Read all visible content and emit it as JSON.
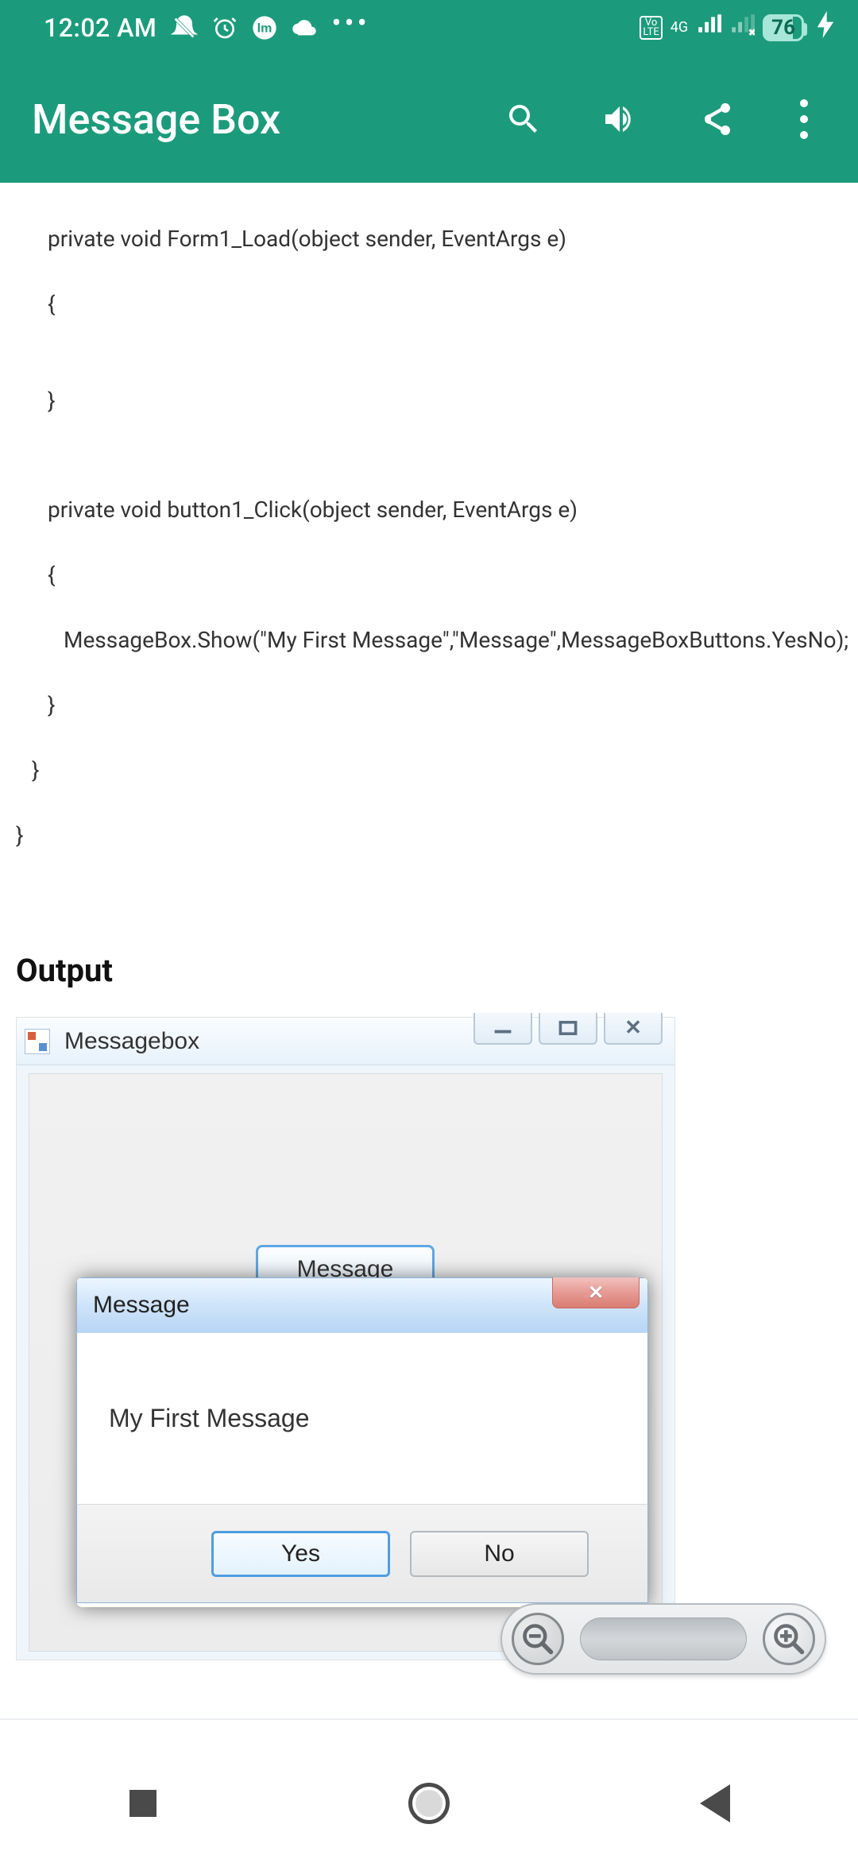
{
  "status": {
    "time": "12:02 AM",
    "network": "4G",
    "volte": "Vo LTE",
    "battery_pct": "76"
  },
  "appbar": {
    "title": "Message Box"
  },
  "code": {
    "l1": "private void Form1_Load(object sender, EventArgs e)",
    "l2": "{",
    "l3": "}",
    "l4": "private void button1_Click(object sender, EventArgs e)",
    "l5": "{",
    "l6": "MessageBox.Show(\"My First Message\",\"Message\",MessageBoxButtons.YesNo);",
    "l7": "}",
    "l8": "}",
    "l9": "}"
  },
  "output": {
    "heading": "Output",
    "window_title": "Messagebox",
    "button_label": "Message",
    "dialog_title": "Message",
    "dialog_text": "My First Message",
    "yes": "Yes",
    "no": "No"
  }
}
